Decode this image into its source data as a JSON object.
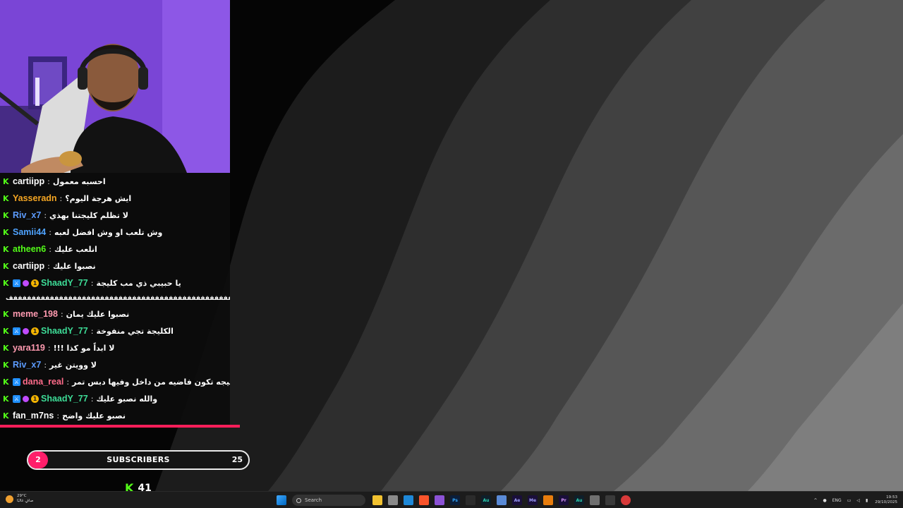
{
  "chat": {
    "messages": [
      {
        "user": "cartiipp",
        "color": "#ffffff",
        "badges": [],
        "text": "احسبه معمول"
      },
      {
        "user": "Yasseradn",
        "color": "#f5a623",
        "badges": [],
        "text": "ايش هرجة اليوم؟"
      },
      {
        "user": "Riv_x7",
        "color": "#5c9cff",
        "badges": [],
        "text": "لا تظلم كليجتنا بهذي"
      },
      {
        "user": "Samii44",
        "color": "#4fa3ff",
        "badges": [],
        "text": "وش تلعب او وش افضل لعبه"
      },
      {
        "user": "atheen6",
        "color": "#53fc18",
        "badges": [],
        "text": "انلعب عليك"
      },
      {
        "user": "cartiipp",
        "color": "#ffffff",
        "badges": [],
        "text": "نصبوا عليك"
      },
      {
        "user": "ShaadY_77",
        "color": "#3ddc97",
        "badges": [
          "mod",
          "dot",
          "coin"
        ],
        "text": "يا حبيبي ذي مب كليجة"
      },
      {
        "user": "",
        "color": "#ffffff",
        "badges": [],
        "text": "فففففففففففففففففففففففففففففففففففففففففففففففففففففففففففففف",
        "spam": true
      },
      {
        "user": "meme_198",
        "color": "#ff9ab0",
        "badges": [],
        "text": "نصبوا عليك يمان"
      },
      {
        "user": "ShaadY_77",
        "color": "#3ddc97",
        "badges": [
          "mod",
          "dot",
          "coin"
        ],
        "text": "الكليجة تجي منفوخة"
      },
      {
        "user": "yara119",
        "color": "#ff9ab0",
        "badges": [],
        "text": "لا ابداً مو كذا !!!"
      },
      {
        "user": "Riv_x7",
        "color": "#5c9cff",
        "badges": [],
        "text": "لا وويتن غير"
      },
      {
        "user": "dana_real",
        "color": "#ff6b8a",
        "badges": [
          "mod"
        ],
        "text": "الكليجه تكون فاضيه من داخل وفيها دبس تمر"
      },
      {
        "user": "ShaadY_77",
        "color": "#3ddc97",
        "badges": [
          "mod",
          "dot",
          "coin"
        ],
        "text": "والله نصبو عليك"
      },
      {
        "user": "fan_m7ns",
        "color": "#ffffff",
        "badges": [],
        "text": "نصبو عليك واضح"
      }
    ]
  },
  "subscribers": {
    "count": "2",
    "label": "SUBSCRIBERS",
    "target": "25"
  },
  "followers": {
    "count": "41"
  },
  "taskbar": {
    "weather_temp": "29°C",
    "weather_desc": "صافٍ غالبًا",
    "search_placeholder": "Search",
    "lang": "ENG",
    "time": "19:53",
    "date": "29/10/2025"
  },
  "colors": {
    "kick_green": "#53fc18",
    "accent_pink": "#ff1e5a"
  }
}
